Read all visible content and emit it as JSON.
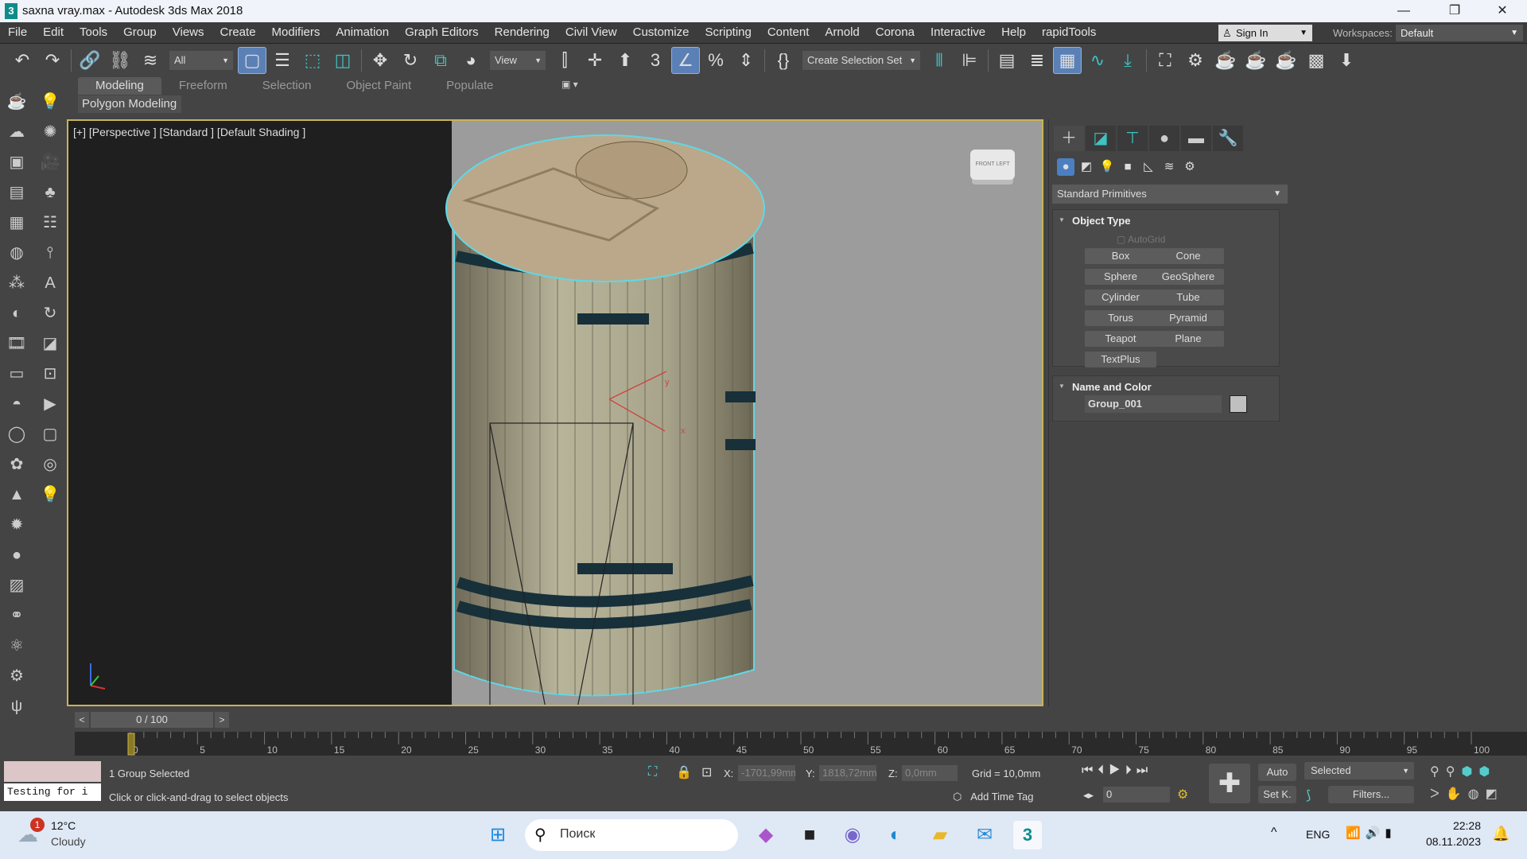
{
  "window": {
    "title": "saxna vray.max - Autodesk 3ds Max 2018",
    "app_icon": "3",
    "controls": [
      "—",
      "❐",
      "✕"
    ]
  },
  "menu": [
    "File",
    "Edit",
    "Tools",
    "Group",
    "Views",
    "Create",
    "Modifiers",
    "Animation",
    "Graph Editors",
    "Rendering",
    "Civil View",
    "Customize",
    "Scripting",
    "Content",
    "Arnold",
    "Corona",
    "Interactive",
    "Help",
    "rapidTools"
  ],
  "account": {
    "sign_in": "Sign In",
    "workspaces_label": "Workspaces:",
    "workspace": "Default"
  },
  "toolbar": {
    "selection_filter": "All",
    "ref_coord": "View",
    "selection_set": "Create Selection Set",
    "icons": [
      {
        "n": "undo-icon",
        "g": "↶"
      },
      {
        "n": "redo-icon",
        "g": "↷"
      },
      {
        "n": "sep"
      },
      {
        "n": "link-icon",
        "g": "🔗"
      },
      {
        "n": "unlink-icon",
        "g": "⛓"
      },
      {
        "n": "bind-spacewarp-icon",
        "g": "≋"
      },
      {
        "n": "filter"
      },
      {
        "n": "select-object-icon",
        "g": "▢",
        "a": 1
      },
      {
        "n": "select-by-name-icon",
        "g": "☰"
      },
      {
        "n": "rect-selection-icon",
        "g": "⬚",
        "t": 1
      },
      {
        "n": "window-crossing-icon",
        "g": "◫",
        "t": 1
      },
      {
        "n": "sep"
      },
      {
        "n": "move-icon",
        "g": "✥"
      },
      {
        "n": "rotate-icon",
        "g": "↻"
      },
      {
        "n": "scale-icon",
        "g": "⧉",
        "t": 1
      },
      {
        "n": "place-icon",
        "g": "◕"
      },
      {
        "n": "refcoord"
      },
      {
        "n": "pivot-icon",
        "g": "⫿"
      },
      {
        "n": "select-manipulate-icon",
        "g": "✛"
      },
      {
        "n": "keyboard-shortcut-icon",
        "g": "⬆"
      },
      {
        "n": "snaps-icon",
        "g": "3"
      },
      {
        "n": "angle-snap-icon",
        "g": "∠",
        "a": 1
      },
      {
        "n": "percent-snap-icon",
        "g": "%"
      },
      {
        "n": "spinner-snap-icon",
        "g": "⇕"
      },
      {
        "n": "sep"
      },
      {
        "n": "edit-named-sets-icon",
        "g": "{}"
      },
      {
        "n": "selset"
      },
      {
        "n": "mirror-icon",
        "g": "⫴",
        "t": 1
      },
      {
        "n": "align-icon",
        "g": "⊫"
      },
      {
        "n": "sep"
      },
      {
        "n": "scene-explorer-icon",
        "g": "▤"
      },
      {
        "n": "layer-explorer-icon",
        "g": "≣"
      },
      {
        "n": "ribbon-toggle-icon",
        "g": "▦",
        "a": 1
      },
      {
        "n": "curve-editor-icon",
        "g": "∿",
        "t": 1
      },
      {
        "n": "dope-sheet-icon",
        "g": "⤓",
        "t": 1
      },
      {
        "n": "sep"
      },
      {
        "n": "schematic-view-icon",
        "g": "⛶"
      },
      {
        "n": "material-editor-icon",
        "g": "⚙"
      },
      {
        "n": "render-setup-icon",
        "g": "☕",
        "t": 1
      },
      {
        "n": "rendered-frame-icon",
        "g": "☕"
      },
      {
        "n": "render-production-icon",
        "g": "☕",
        "t": 1
      },
      {
        "n": "render-cloud-icon",
        "g": "▩"
      },
      {
        "n": "render-extra-icon",
        "g": "⬇"
      }
    ]
  },
  "ribbon": {
    "tabs": [
      "Modeling",
      "Freeform",
      "Selection",
      "Object Paint",
      "Populate"
    ],
    "active": "Modeling",
    "panel": "Polygon Modeling"
  },
  "viewport": {
    "label": "[+] [Perspective ] [Standard ] [Default Shading ]",
    "viewcube": "FRONT LEFT"
  },
  "command_panel": {
    "category": "Standard Primitives",
    "object_type": {
      "title": "Object Type",
      "autogrid": "AutoGrid",
      "buttons": [
        "Box",
        "Cone",
        "Sphere",
        "GeoSphere",
        "Cylinder",
        "Tube",
        "Torus",
        "Pyramid",
        "Teapot",
        "Plane",
        "TextPlus"
      ]
    },
    "name_color": {
      "title": "Name and Color",
      "name": "Group_001",
      "color": "#c0c0c0"
    }
  },
  "timeline": {
    "frame": "0 / 100",
    "prev": "<",
    "next": ">",
    "current": 0,
    "end": 100,
    "labels": [
      0,
      5,
      10,
      15,
      20,
      25,
      30,
      35,
      40,
      45,
      50,
      55,
      60,
      65,
      70,
      75,
      80,
      85,
      90,
      95,
      100
    ]
  },
  "status": {
    "maxscript": "Testing for i",
    "selection": "1 Group Selected",
    "prompt": "Click or click-and-drag to select objects",
    "x_label": "X:",
    "x": "-1701,99mm",
    "y_label": "Y:",
    "y": "1818,72mm",
    "z_label": "Z:",
    "z": "0,0mm",
    "grid": "Grid = 10,0mm",
    "add_time_tag": "Add Time Tag",
    "frame_field": "0",
    "auto": "Auto",
    "set_key": "Set K.",
    "key_filter": "Selected",
    "filters": "Filters..."
  },
  "taskbar": {
    "weather_temp": "12°C",
    "weather_desc": "Cloudy",
    "weather_badge": "1",
    "search_placeholder": "Поиск",
    "lang": "ENG",
    "time": "22:28",
    "date": "08.11.2023"
  }
}
